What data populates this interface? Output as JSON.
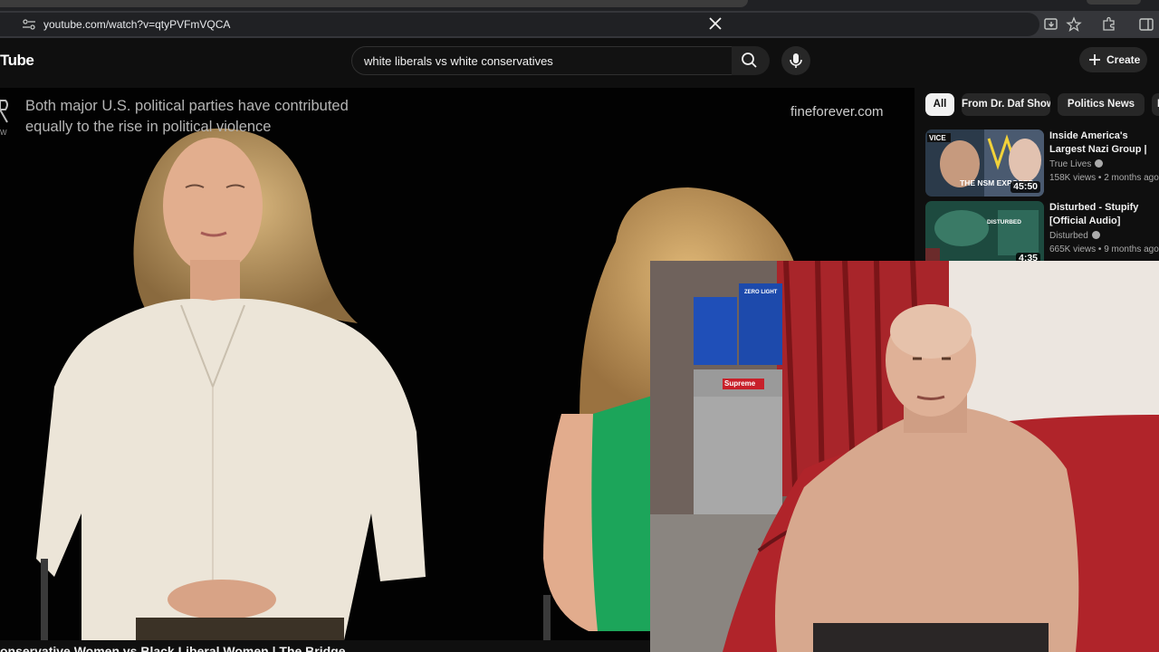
{
  "browser": {
    "url": "youtube.com/watch?v=qtyPVFmVQCA"
  },
  "header": {
    "logo_text": "Tube",
    "search_query": "white liberals vs white conservatives",
    "create_label": "Create"
  },
  "video": {
    "overlay_line1": "Both major U.S. political parties have contributed",
    "overlay_line2": "equally to the rise in political violence",
    "watermark": "fineforever.com",
    "title_partial": "onservative Women vs Black Liberal Women | The Bridge"
  },
  "chips": [
    "All",
    "From Dr. Daf Show",
    "Politics News",
    "R"
  ],
  "recommendations": [
    {
      "title": "Inside America's Largest Nazi Group | Vice: Hate T",
      "channel": "True Lives",
      "meta": "158K views • 2 months ago",
      "duration": "45:50",
      "thumb_text": "THE NSM EXPOSED"
    },
    {
      "title": "Disturbed - Stupify [Official Audio]",
      "channel": "Disturbed",
      "meta": "665K views • 9 months ago",
      "duration": "4:35",
      "thumb_text": "DISTURBED"
    }
  ],
  "webcam": {
    "box_label": "ZERO LIGHT",
    "fridge_label": "Supreme"
  },
  "colors": {
    "page_bg": "#0f0f0f",
    "chip_bg": "#272727",
    "chip_active_bg": "#f1f1f1",
    "wall_red": "#b0242a"
  }
}
